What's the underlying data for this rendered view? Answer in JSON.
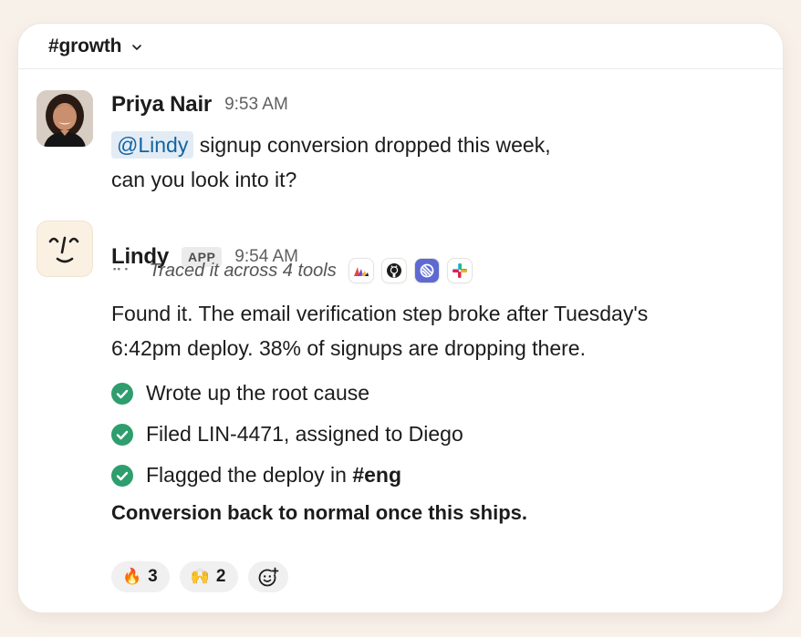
{
  "channel": {
    "name": "#growth",
    "chevron_icon": "chevron-down-icon"
  },
  "messages": [
    {
      "sender": "Priya Nair",
      "time": "9:53 AM",
      "avatar_icon": "user-avatar-photo",
      "mention": "@Lindy",
      "text_line1": "signup conversion dropped this week,",
      "text_line2": "can you look into it?"
    },
    {
      "sender": "Lindy",
      "badge": "APP",
      "time": "9:54 AM",
      "avatar_icon": "lindy-face-logo",
      "trace_text": "Traced it across 4 tools",
      "tools": [
        "mixpanel-icon",
        "github-icon",
        "linear-icon",
        "slack-icon"
      ],
      "body_line1": "Found it. The email verification step broke after Tuesday's",
      "body_line2": "6:42pm deploy. 38% of signups are dropping there.",
      "checklist": [
        {
          "text": "Wrote up the root cause"
        },
        {
          "text": "Filed LIN-4471, assigned to Diego"
        },
        {
          "text": "Flagged the deploy in ",
          "bold": "#eng"
        }
      ],
      "conclusion": "Conversion back to normal once this ships.",
      "reactions": [
        {
          "emoji": "🔥",
          "count": "3"
        },
        {
          "emoji": "🙌",
          "count": "2"
        }
      ]
    }
  ],
  "colors": {
    "background": "#f8f1ea",
    "mention_bg": "#e3ecf4",
    "mention_text": "#1264a3",
    "check_green": "#2e9e6e"
  }
}
